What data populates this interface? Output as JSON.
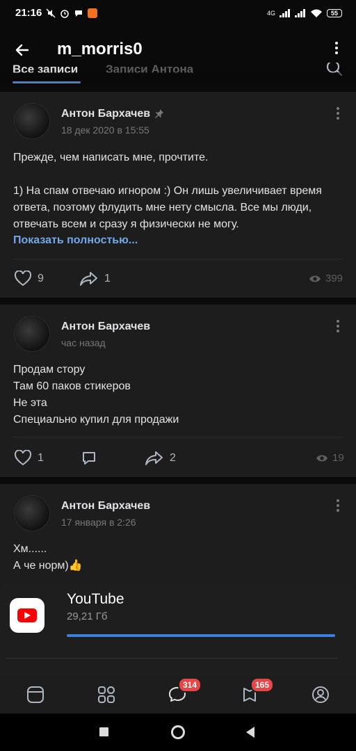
{
  "status": {
    "time": "21:16",
    "battery": "55",
    "network": "4G"
  },
  "header": {
    "title": "m_morris0"
  },
  "tabs": [
    {
      "label": "Все записи",
      "active": true
    },
    {
      "label": "Записи Антона",
      "active": false
    }
  ],
  "posts": [
    {
      "author": "Антон Бархачев",
      "pinned": true,
      "date": "18 дек 2020 в 15:55",
      "text": "Прежде, чем написать мне, прочтите.\n\n1) На спам отвечаю игнором :) Он лишь увеличивает время ответа, поэтому флудить мне нету смысла. Все мы люди, отвечать всем и сразу я физически не могу.",
      "show_more": "Показать полностью...",
      "likes": "9",
      "shares": "1",
      "views": "399"
    },
    {
      "author": "Антон Бархачев",
      "pinned": false,
      "date": "час назад",
      "text": "Продам стору\nТам 60 паков стикеров\nНе эта\nСпециально купил для продажи",
      "likes": "1",
      "shares": "2",
      "views": "19"
    },
    {
      "author": "Антон Бархачев",
      "pinned": false,
      "date": "17 января в 2:26",
      "text": "Хм......\nА че норм)👍"
    }
  ],
  "notification": {
    "app": "YouTube",
    "size": "29,21 Гб",
    "progress": 1.0
  },
  "tabbar": {
    "messages_badge": "314",
    "clips_badge": "165"
  },
  "colors": {
    "accent": "#5181b8",
    "link": "#71aaeb",
    "badge": "#e64646",
    "youtube_red": "#ff0000"
  }
}
